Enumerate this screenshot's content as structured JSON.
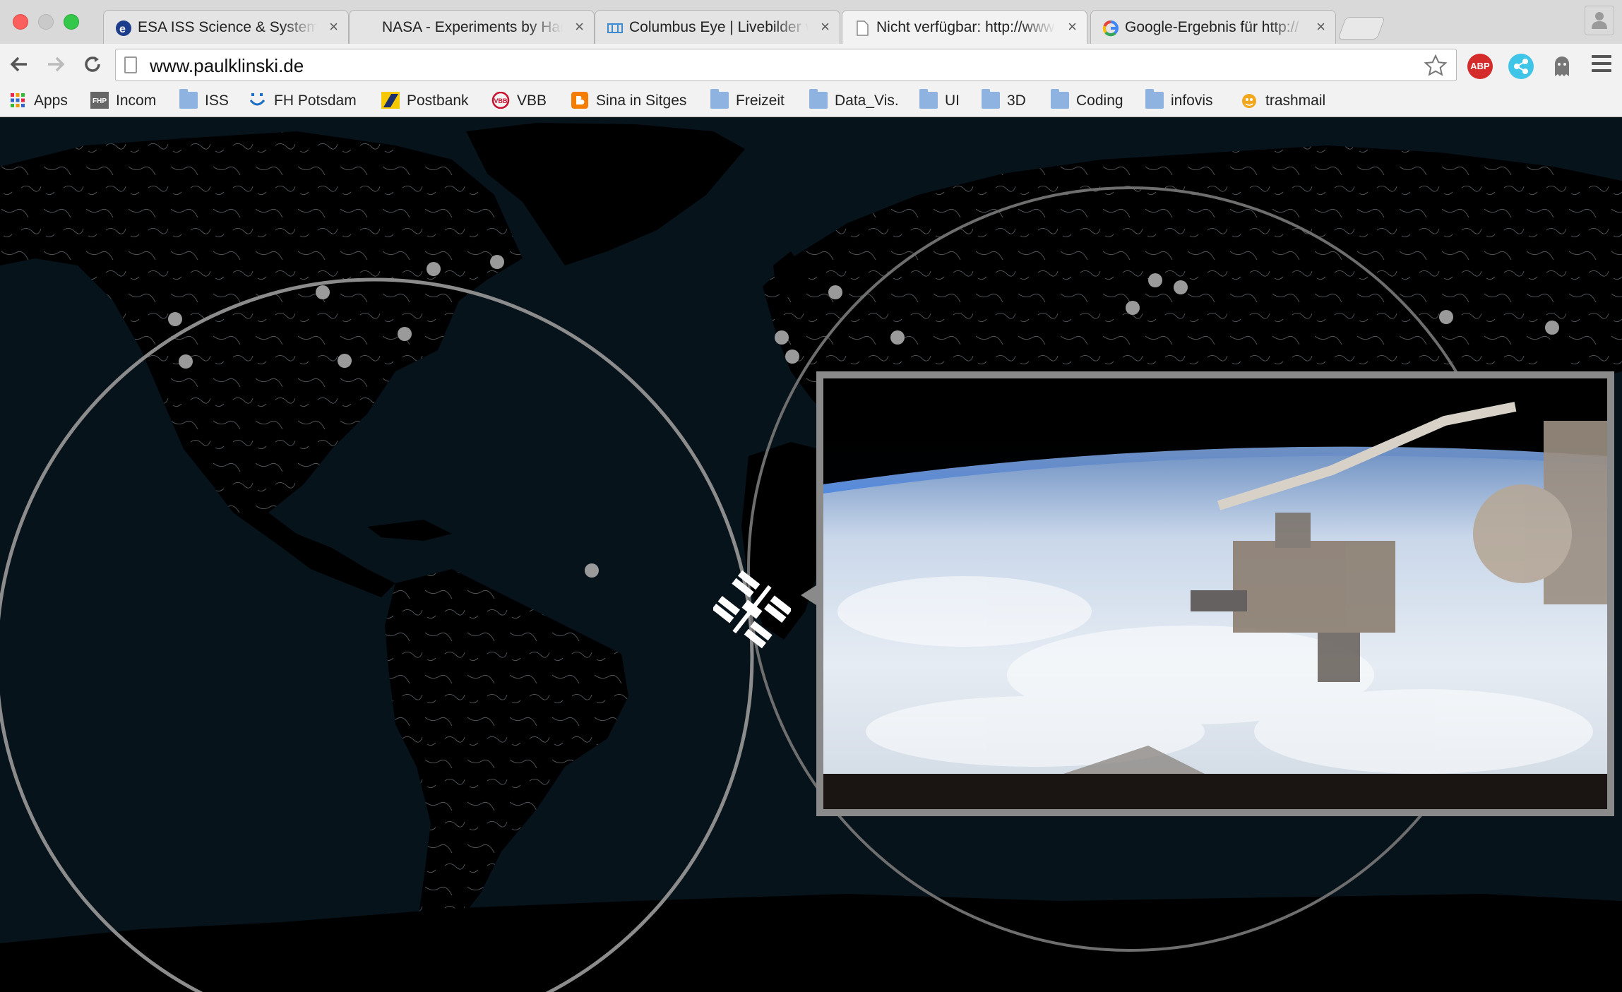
{
  "browser": {
    "tabs": [
      {
        "title": "ESA ISS Science & System",
        "favicon": "esa-icon",
        "active": false
      },
      {
        "title": "NASA - Experiments by Har",
        "favicon": "none",
        "active": false
      },
      {
        "title": "Columbus Eye | Livebilder v",
        "favicon": "columbus-icon",
        "active": false
      },
      {
        "title": "Nicht verfügbar: http://www",
        "favicon": "page-icon",
        "active": true
      },
      {
        "title": "Google-Ergebnis für http://",
        "favicon": "google-icon",
        "active": false
      }
    ],
    "close_glyph": "×",
    "url": "www.paulklinski.de",
    "extensions": {
      "abp_label": "ABP"
    },
    "bookmarks": [
      {
        "label": "Apps",
        "icon": "apps-grid-icon"
      },
      {
        "label": "Incom",
        "icon": "fhp-icon"
      },
      {
        "label": "ISS",
        "icon": "folder-icon"
      },
      {
        "label": "FH Potsdam",
        "icon": "fhp-logo-icon"
      },
      {
        "label": "Postbank",
        "icon": "postbank-icon"
      },
      {
        "label": "VBB",
        "icon": "vbb-icon"
      },
      {
        "label": "Sina in Sitges",
        "icon": "blogger-icon"
      },
      {
        "label": "Freizeit",
        "icon": "folder-icon"
      },
      {
        "label": "Data_Vis.",
        "icon": "folder-icon"
      },
      {
        "label": "UI",
        "icon": "folder-icon"
      },
      {
        "label": "3D",
        "icon": "folder-icon"
      },
      {
        "label": "Coding",
        "icon": "folder-icon"
      },
      {
        "label": "infovis",
        "icon": "folder-icon"
      },
      {
        "label": "trashmail",
        "icon": "trashmail-icon"
      }
    ]
  },
  "colors": {
    "map_background": "#07131b",
    "land": "#000000",
    "rivers": "#d8dde0",
    "dots": "#9a9a9a",
    "range_circle": "#8c8c8c"
  },
  "icons": {
    "iss": "iss-station-icon",
    "video_frame": "live-video-feed"
  }
}
